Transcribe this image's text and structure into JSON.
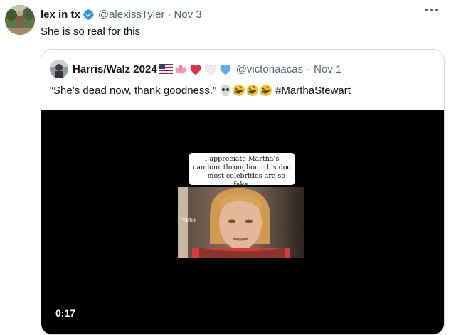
{
  "tweet": {
    "author_name": "lex in tx",
    "author_handle": "@alexissTyler",
    "separator": "·",
    "date": "Nov 3",
    "text": "She is so real for this",
    "verified_icon": "verified-badge-icon",
    "more_icon": "more-options-icon"
  },
  "quote": {
    "author_name": "Harris/Walz 2024",
    "author_emojis": [
      "us-flag-icon",
      "lotus-icon",
      "red-heart-icon",
      "white-heart-icon",
      "blue-heart-icon"
    ],
    "author_handle": "@victoriaacas",
    "separator": "·",
    "date": "Nov 1",
    "text": "“She’s dead now, thank goodness.”",
    "text_emojis": [
      "skull-icon",
      "rofl-icon",
      "rofl-icon",
      "rofl-icon"
    ],
    "hashtag": "#MarthaStewart"
  },
  "video": {
    "caption": "I appreciate Martha’s candour throughout this doc — most celebrities are so fake.",
    "watermark": "TikTok",
    "time": "0:17"
  },
  "colors": {
    "text": "#0f1419",
    "secondary": "#536471",
    "verified": "#1d9bf0",
    "border": "#cfd9de"
  }
}
